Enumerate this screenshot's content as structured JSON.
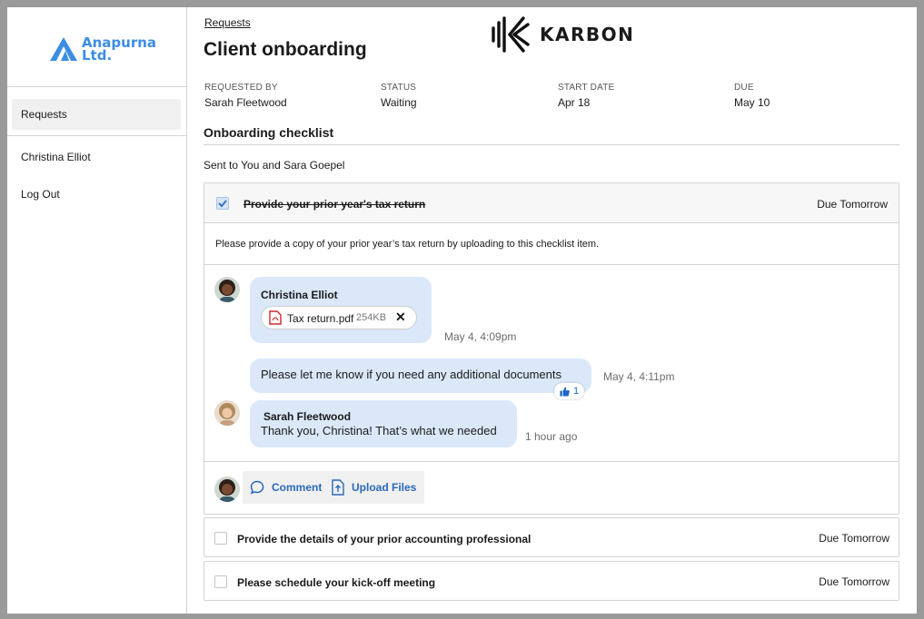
{
  "sidebar": {
    "logo_line1": "Anapurna",
    "logo_line2": "Ltd.",
    "nav_requests": "Requests",
    "user_name": "Christina Elliot",
    "logout": "Log Out"
  },
  "header": {
    "breadcrumb": "Requests",
    "title": "Client onboarding",
    "brand": "KARBON"
  },
  "meta": [
    {
      "label": "REQUESTED BY",
      "value": "Sarah Fleetwood"
    },
    {
      "label": "STATUS",
      "value": "Waiting"
    },
    {
      "label": "START DATE",
      "value": "Apr 18"
    },
    {
      "label": "DUE",
      "value": "May 10"
    }
  ],
  "checklist": {
    "title": "Onboarding checklist",
    "sent_to": "Sent to You and Sara Goepel",
    "items": [
      {
        "title": "Provide your prior year's tax return",
        "due": "Due Tomorrow",
        "checked": true,
        "description": "Please provide a copy of your prior year’s tax return by uploading to this checklist item."
      },
      {
        "title": "Provide the details of your prior accounting professional",
        "due": "Due Tomorrow",
        "checked": false
      },
      {
        "title": "Please schedule your kick-off meeting",
        "due": "Due Tomorrow",
        "checked": false
      }
    ]
  },
  "thread": {
    "message1": {
      "author": "Christina Elliot",
      "attachment_name": "Tax return.pdf",
      "attachment_size": "254KB",
      "time": "May 4, 4:09pm"
    },
    "message2": {
      "text": "Please let me know if you need any additional documents",
      "time": "May 4, 4:11pm",
      "reaction_count": "1"
    },
    "message3": {
      "author": "Sarah Fleetwood",
      "text": "Thank you, Christina! That’s what we needed",
      "time": "1 hour ago"
    }
  },
  "actions": {
    "comment": "Comment",
    "upload": "Upload Files"
  },
  "colors": {
    "accent": "#2a68b8",
    "logo_blue": "#3d8de4",
    "bubble": "#dbe8fa",
    "pdf_red": "#d0282e"
  }
}
